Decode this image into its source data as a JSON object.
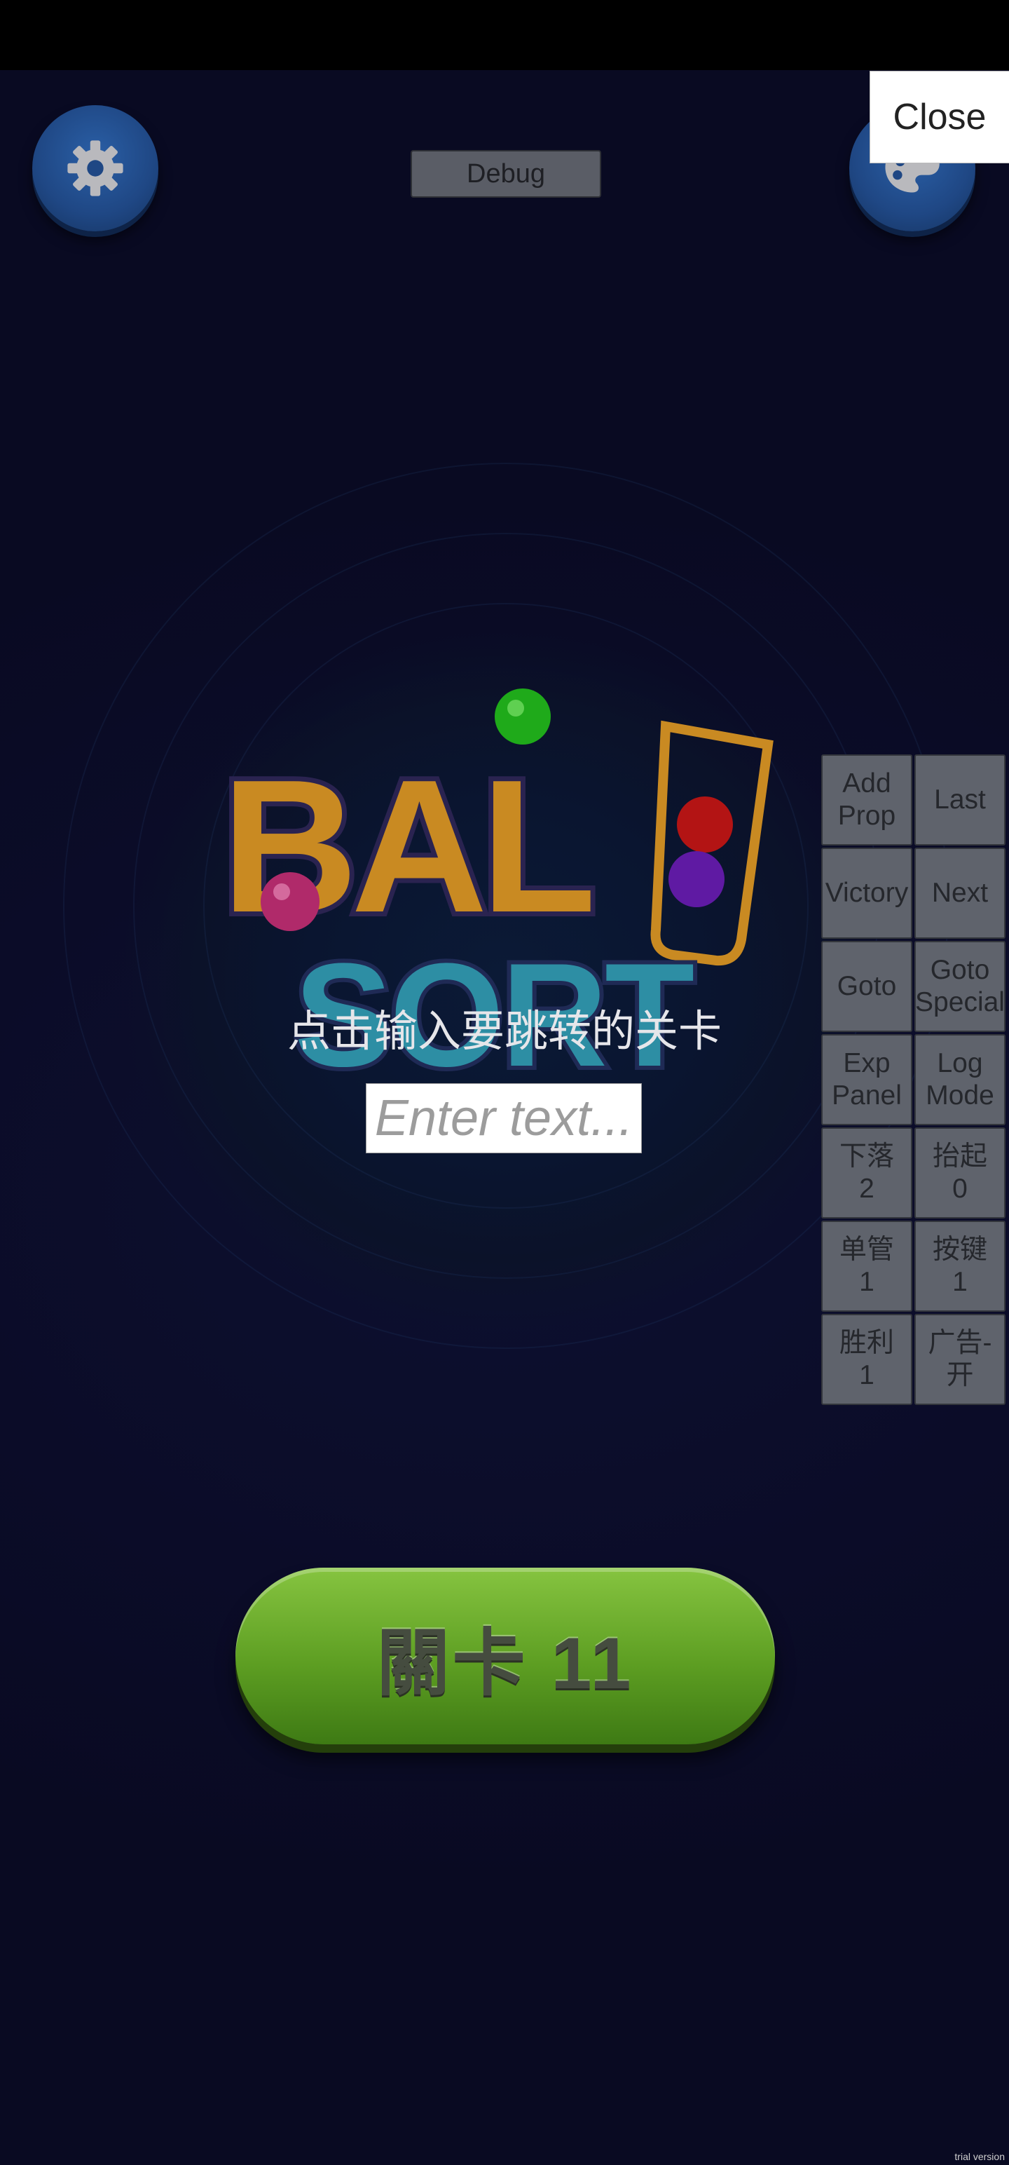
{
  "header": {
    "debug_label": "Debug",
    "close_label": "Close"
  },
  "icons": {
    "settings": "gear-icon",
    "theme": "palette-icon"
  },
  "logo": {
    "line1": "BALL",
    "line2": "SORT"
  },
  "goto_prompt": "点击输入要跳转的关卡",
  "goto_input": {
    "placeholder": "Enter text...",
    "value": ""
  },
  "debug_panel": [
    [
      "Add\nProp",
      "Last"
    ],
    [
      "Victory",
      "Next"
    ],
    [
      "Goto",
      "Goto\nSpecial"
    ],
    [
      "Exp\nPanel",
      "Log\nMode"
    ],
    [
      "下落\n2",
      "抬起\n0"
    ],
    [
      "单管\n1",
      "按键\n1"
    ],
    [
      "胜利\n1",
      "广告-开"
    ]
  ],
  "level_button": {
    "label": "關卡 11"
  },
  "watermark": "trial version",
  "colors": {
    "accent_green": "#5d9e22",
    "button_blue": "#1f4784",
    "background": "#0b0c28"
  }
}
